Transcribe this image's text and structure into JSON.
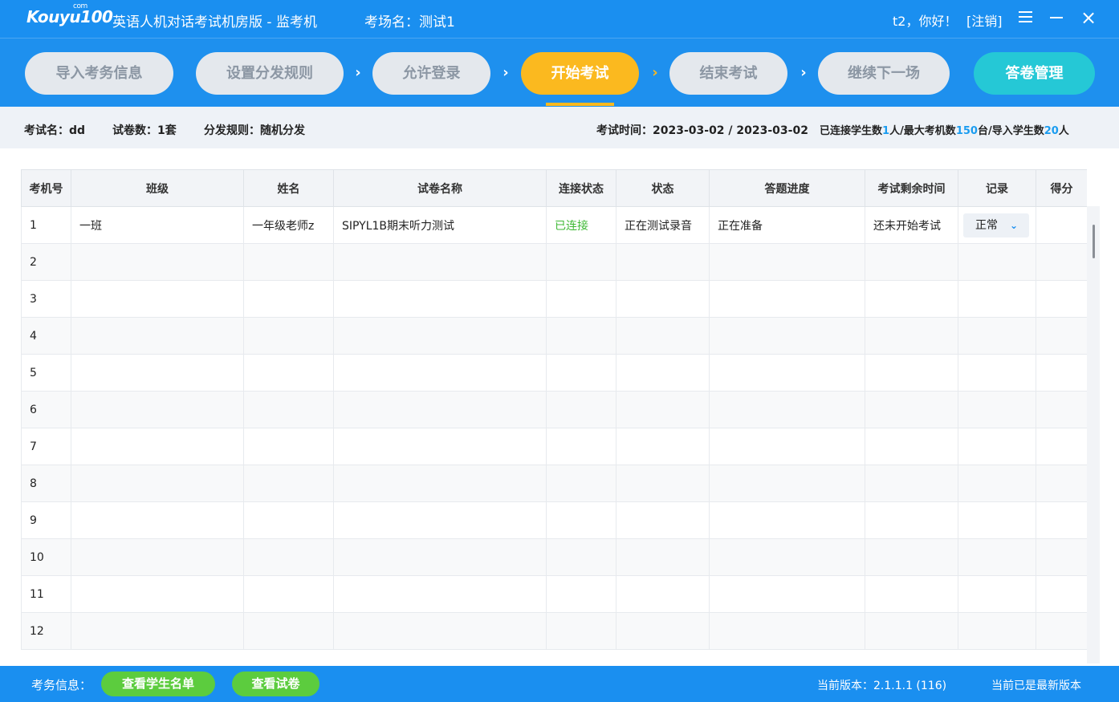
{
  "app": {
    "logo": "Kouyu100",
    "logo_com": "com",
    "title": "英语人机对话考试机房版 - 监考机",
    "room": "考场名：测试1",
    "user_greeting": "t2，你好！",
    "logout": "[注销]"
  },
  "steps": [
    {
      "label": "导入考务信息",
      "state": "disabled"
    },
    {
      "label": "设置分发规则",
      "state": "disabled"
    },
    {
      "label": "允许登录",
      "state": "disabled"
    },
    {
      "label": "开始考试",
      "state": "active"
    },
    {
      "label": "结束考试",
      "state": "disabled"
    },
    {
      "label": "继续下一场",
      "state": "disabled"
    }
  ],
  "manage_button": "答卷管理",
  "info": {
    "exam_name": "考试名：dd",
    "paper_count": "试卷数：1套",
    "rule": "分发规则：随机分发",
    "exam_time": "考试时间：2023-03-02 / 2023-03-02",
    "conn_prefix": "已连接学生数",
    "conn_count": "1",
    "conn_mid1": "人/最大考机数",
    "max_machines": "150",
    "conn_mid2": "台/导入学生数",
    "imported": "20",
    "conn_suffix": "人"
  },
  "table": {
    "columns": [
      "考机号",
      "班级",
      "姓名",
      "试卷名称",
      "连接状态",
      "状态",
      "答题进度",
      "考试剩余时间",
      "记录",
      "得分"
    ],
    "rows": [
      {
        "no": "1",
        "class": "一班",
        "name": "一年级老师z",
        "paper": "SIPYL1B期末听力测试",
        "conn": "已连接",
        "status": "正在测试录音",
        "progress": "正在准备",
        "remaining": "还未开始考试",
        "record": "正常",
        "score": ""
      },
      {
        "no": "2",
        "class": "",
        "name": "",
        "paper": "",
        "conn": "",
        "status": "",
        "progress": "",
        "remaining": "",
        "record": "",
        "score": ""
      },
      {
        "no": "3",
        "class": "",
        "name": "",
        "paper": "",
        "conn": "",
        "status": "",
        "progress": "",
        "remaining": "",
        "record": "",
        "score": ""
      },
      {
        "no": "4",
        "class": "",
        "name": "",
        "paper": "",
        "conn": "",
        "status": "",
        "progress": "",
        "remaining": "",
        "record": "",
        "score": ""
      },
      {
        "no": "5",
        "class": "",
        "name": "",
        "paper": "",
        "conn": "",
        "status": "",
        "progress": "",
        "remaining": "",
        "record": "",
        "score": ""
      },
      {
        "no": "6",
        "class": "",
        "name": "",
        "paper": "",
        "conn": "",
        "status": "",
        "progress": "",
        "remaining": "",
        "record": "",
        "score": ""
      },
      {
        "no": "7",
        "class": "",
        "name": "",
        "paper": "",
        "conn": "",
        "status": "",
        "progress": "",
        "remaining": "",
        "record": "",
        "score": ""
      },
      {
        "no": "8",
        "class": "",
        "name": "",
        "paper": "",
        "conn": "",
        "status": "",
        "progress": "",
        "remaining": "",
        "record": "",
        "score": ""
      },
      {
        "no": "9",
        "class": "",
        "name": "",
        "paper": "",
        "conn": "",
        "status": "",
        "progress": "",
        "remaining": "",
        "record": "",
        "score": ""
      },
      {
        "no": "10",
        "class": "",
        "name": "",
        "paper": "",
        "conn": "",
        "status": "",
        "progress": "",
        "remaining": "",
        "record": "",
        "score": ""
      },
      {
        "no": "11",
        "class": "",
        "name": "",
        "paper": "",
        "conn": "",
        "status": "",
        "progress": "",
        "remaining": "",
        "record": "",
        "score": ""
      },
      {
        "no": "12",
        "class": "",
        "name": "",
        "paper": "",
        "conn": "",
        "status": "",
        "progress": "",
        "remaining": "",
        "record": "",
        "score": ""
      }
    ]
  },
  "footer": {
    "label": "考务信息：",
    "btn_students": "查看学生名单",
    "btn_papers": "查看试卷",
    "version": "当前版本：2.1.1.1 (116)",
    "latest": "当前已是最新版本"
  },
  "colors": {
    "primary": "#1a8ff0",
    "active_step": "#fbb91f",
    "manage": "#25c8d6",
    "green": "#5ccc3e",
    "connected": "#3fb935"
  },
  "icons": [
    "menu-icon",
    "minimize-icon",
    "close-icon",
    "chevron-right-icon",
    "chevron-down-icon"
  ]
}
